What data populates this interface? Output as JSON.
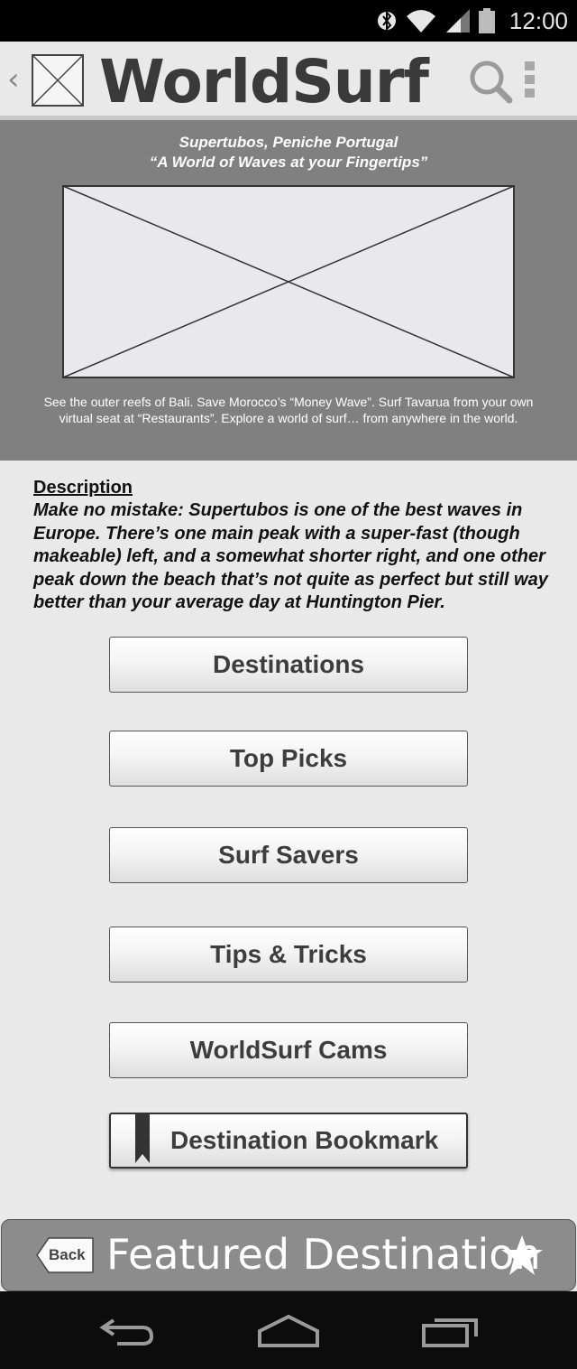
{
  "status_bar": {
    "time": "12:00",
    "icons": [
      "bluetooth-icon",
      "wifi-icon",
      "signal-icon",
      "battery-icon"
    ]
  },
  "action_bar": {
    "title": "WorldSurf",
    "icons": [
      "up-chevron-icon",
      "app-logo-placeholder",
      "search-icon",
      "overflow-menu-icon"
    ]
  },
  "hero": {
    "title": "Supertubos, Peniche Portugal",
    "tagline": "“A World of Waves at your Fingertips”",
    "caption": "See the outer reefs of Bali. Save Morocco’s “Money Wave”. Surf Tavarua from your own virtual seat at “Restaurants”. Explore a world of surf… from anywhere in the world."
  },
  "description": {
    "heading": "Description",
    "body": "Make no mistake: Supertubos is one of the best waves in Europe. There’s one main peak with a super-fast (though makeable) left, and a somewhat shorter right, and one other peak down the beach that’s not quite as perfect but still way better than your average day at Huntington Pier."
  },
  "menu": {
    "destinations": "Destinations",
    "top_picks": "Top Picks",
    "surf_savers": "Surf Savers",
    "tips_tricks": "Tips & Tricks",
    "cams": "WorldSurf Cams",
    "bookmark": "Destination Bookmark"
  },
  "featured_bar": {
    "back_label": "Back",
    "title": "Featured Destination"
  },
  "colors": {
    "hero_bg": "#808080",
    "page_bg": "#e9e9e9",
    "featured_bg": "#8c8c8c",
    "status_bar_bg": "#000000"
  }
}
